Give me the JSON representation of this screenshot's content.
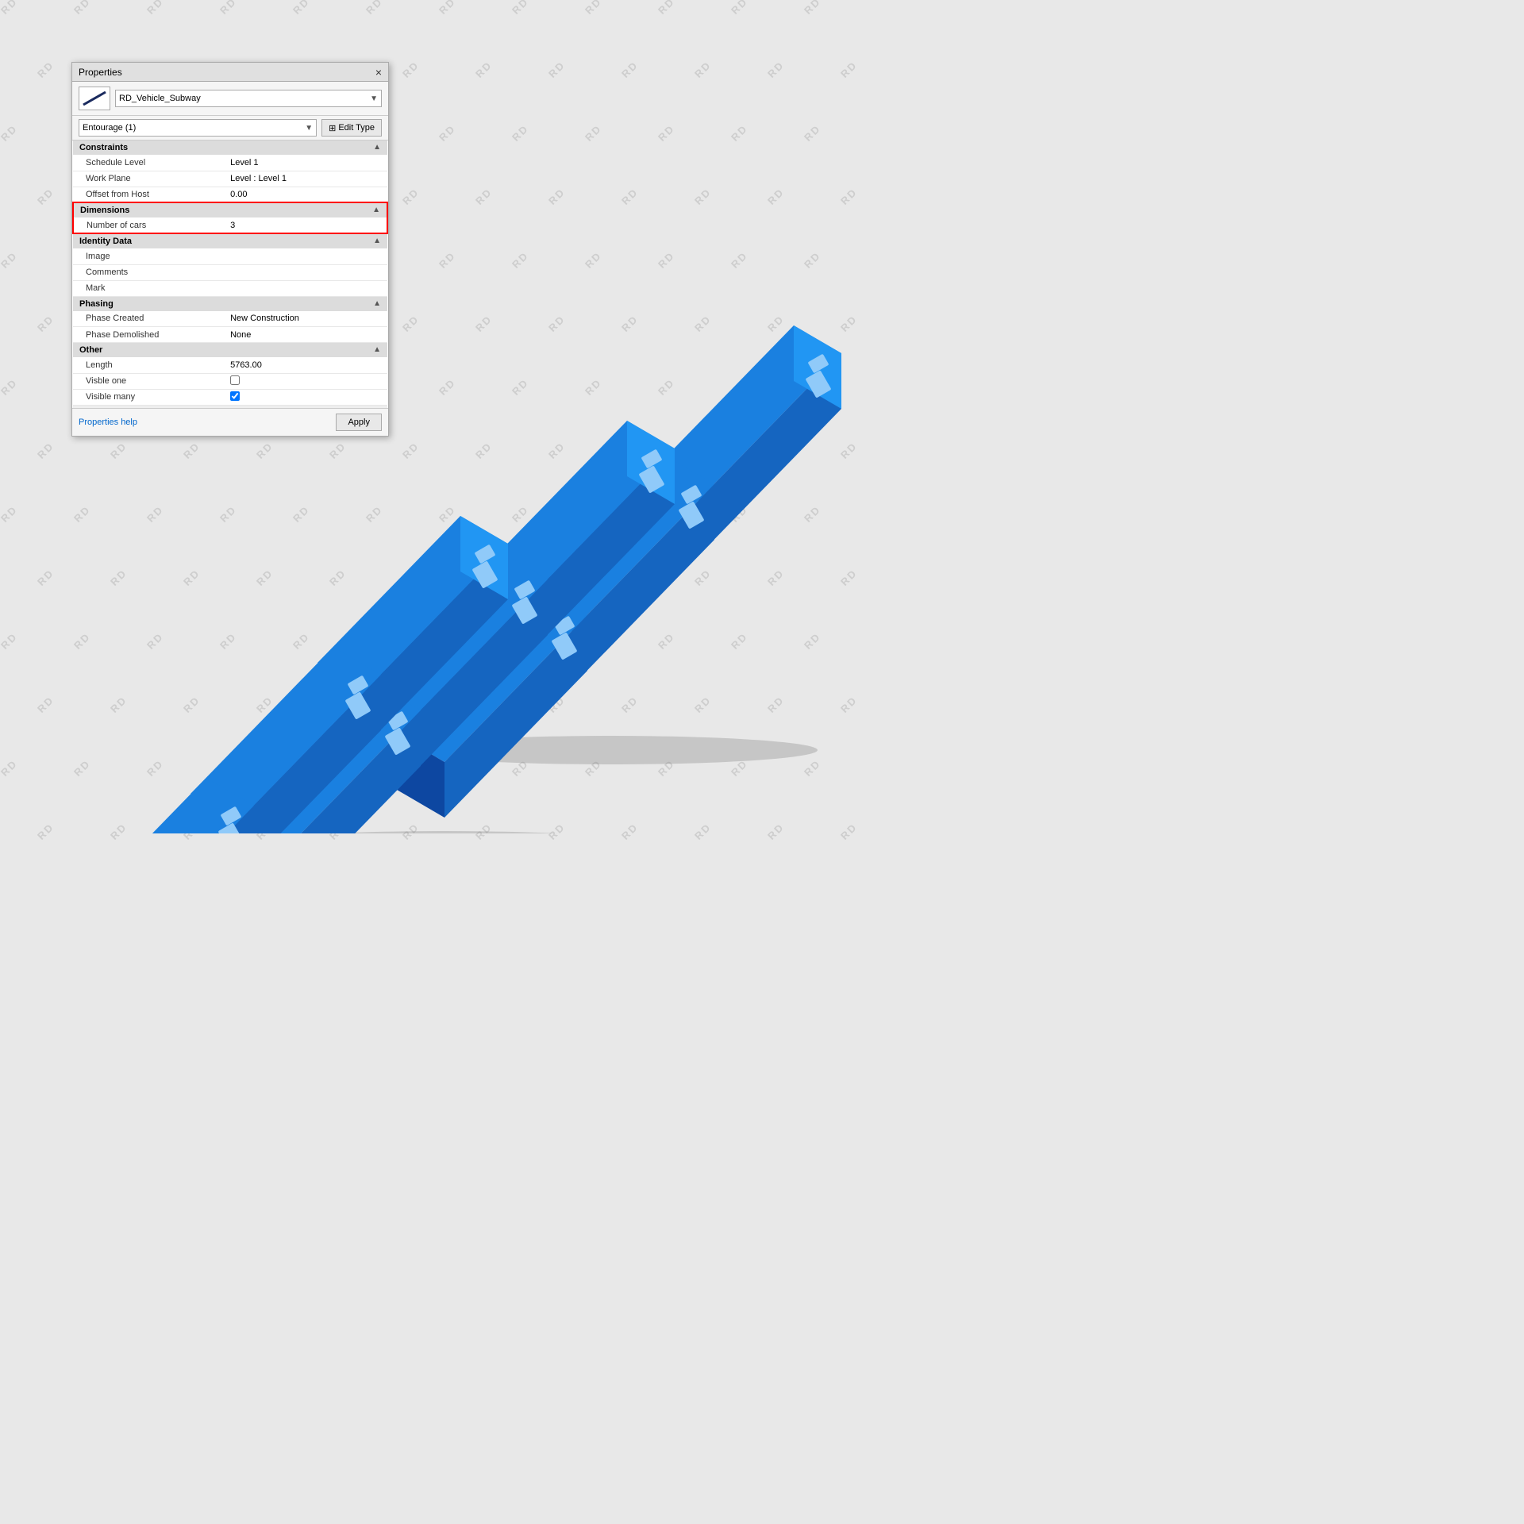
{
  "panel": {
    "title": "Properties",
    "close_label": "×",
    "type_icon_alt": "subway-vehicle-icon",
    "type_name": "RD_Vehicle_Subway",
    "filter_label": "Entourage (1)",
    "edit_type_label": "Edit Type",
    "sections": {
      "constraints": {
        "label": "Constraints",
        "rows": [
          {
            "label": "Schedule Level",
            "value": "Level 1"
          },
          {
            "label": "Work Plane",
            "value": "Level : Level 1"
          },
          {
            "label": "Offset from Host",
            "value": "0.00"
          }
        ]
      },
      "dimensions": {
        "label": "Dimensions",
        "rows": [
          {
            "label": "Number of cars",
            "value": "3"
          }
        ]
      },
      "identity_data": {
        "label": "Identity Data",
        "rows": [
          {
            "label": "Image",
            "value": ""
          },
          {
            "label": "Comments",
            "value": ""
          },
          {
            "label": "Mark",
            "value": ""
          }
        ]
      },
      "phasing": {
        "label": "Phasing",
        "rows": [
          {
            "label": "Phase Created",
            "value": "New Construction"
          },
          {
            "label": "Phase Demolished",
            "value": "None"
          }
        ]
      },
      "other": {
        "label": "Other",
        "rows": [
          {
            "label": "Length",
            "value": "5763.00"
          },
          {
            "label": "Visble one",
            "value": "",
            "type": "checkbox",
            "checked": false
          },
          {
            "label": "Visible many",
            "value": "",
            "type": "checkbox",
            "checked": true
          }
        ]
      }
    },
    "bottom": {
      "help_label": "Properties help",
      "apply_label": "Apply"
    }
  },
  "watermarks": [
    "RD",
    "RD",
    "RD"
  ],
  "trains": {
    "count": 3,
    "color": "#2196F3",
    "dark_color": "#1565C0",
    "window_color": "#90CAF9",
    "shadow_color": "rgba(100,100,100,0.3)"
  }
}
